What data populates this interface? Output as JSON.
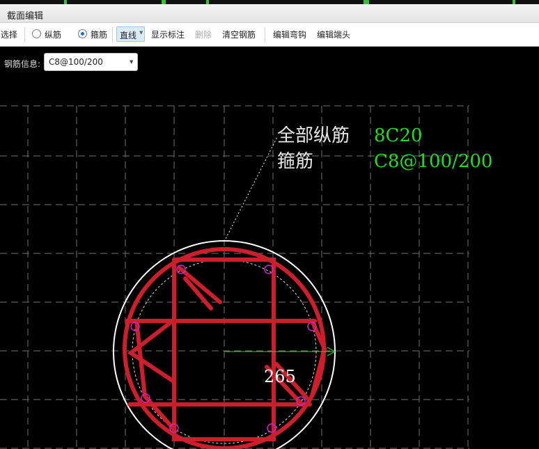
{
  "window": {
    "title": "截面编辑"
  },
  "toolbar": {
    "select": "选择",
    "longitudinal": "纵筋",
    "stirrup": "箍筋",
    "line_mode": "直线",
    "show_labels": "显示标注",
    "delete": "删除",
    "clear_rebar": "清空钢筋",
    "edit_hook": "编辑弯钩",
    "edit_end": "编辑端头"
  },
  "rebar_info": {
    "label": "钢筋信息:",
    "value": "C8@100/200"
  },
  "annotation": {
    "all_long_label": "全部纵筋",
    "all_long_value": "8C20",
    "stirrup_label": "箍筋",
    "stirrup_value": "C8@100/200"
  },
  "dimension": {
    "value": "265"
  },
  "colors": {
    "rebar": "#cc1f2b",
    "bar_marker": "#cc22cc",
    "value_green": "#22dd22",
    "grid": "#9a9a9a",
    "section_outline": "#ffffff"
  }
}
